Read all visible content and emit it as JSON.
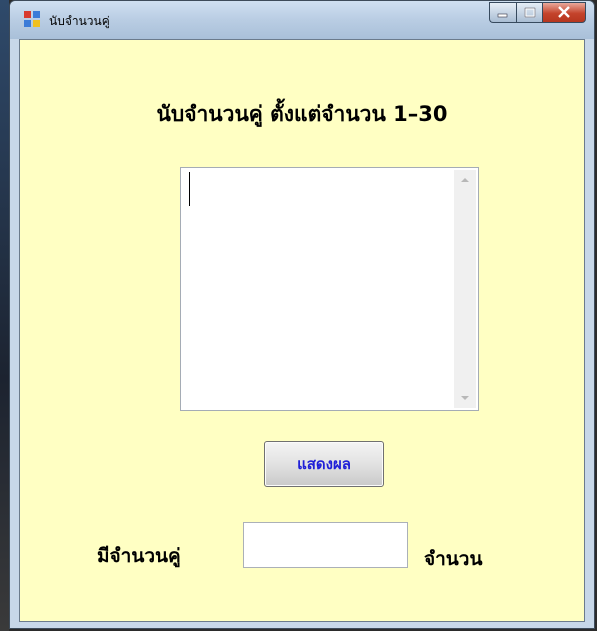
{
  "window": {
    "title": "นับจำนวนคู่",
    "controls": {
      "minimize": "minimize-icon",
      "maximize": "maximize-icon",
      "close": "close-icon"
    }
  },
  "form": {
    "heading": "นับจำนวนคู่ ตั้งแต่จำนวน 1–30",
    "output_text": "",
    "show_button_label": "แสดงผล",
    "count_label": "มีจำนวนคู่",
    "count_value": "",
    "unit_label": "จำนวน"
  },
  "colors": {
    "form_background": "#ffffc3",
    "button_text": "#2020d8"
  }
}
